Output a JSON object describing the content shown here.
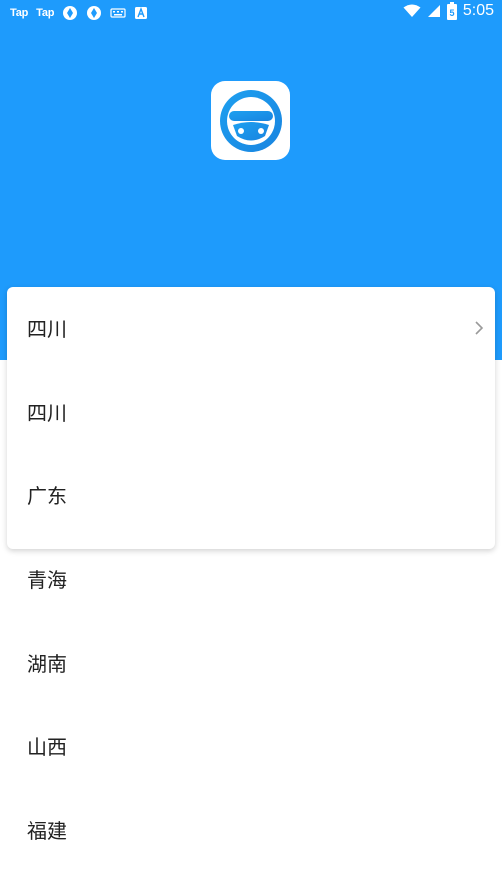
{
  "status_bar": {
    "tap_1": "Tap",
    "tap_2": "Tap",
    "time": "5:05",
    "battery_level": "5"
  },
  "colors": {
    "header": "#1E9BFC",
    "accent": "#1EA0F0",
    "text": "#222222"
  },
  "icons": {
    "logo": "steering-wheel-icon",
    "chevron": "chevron-right-icon"
  },
  "regions": [
    {
      "label": "四川"
    },
    {
      "label": "四川"
    },
    {
      "label": "广东"
    },
    {
      "label": "青海"
    },
    {
      "label": "湖南"
    },
    {
      "label": "山西"
    },
    {
      "label": "福建"
    }
  ]
}
